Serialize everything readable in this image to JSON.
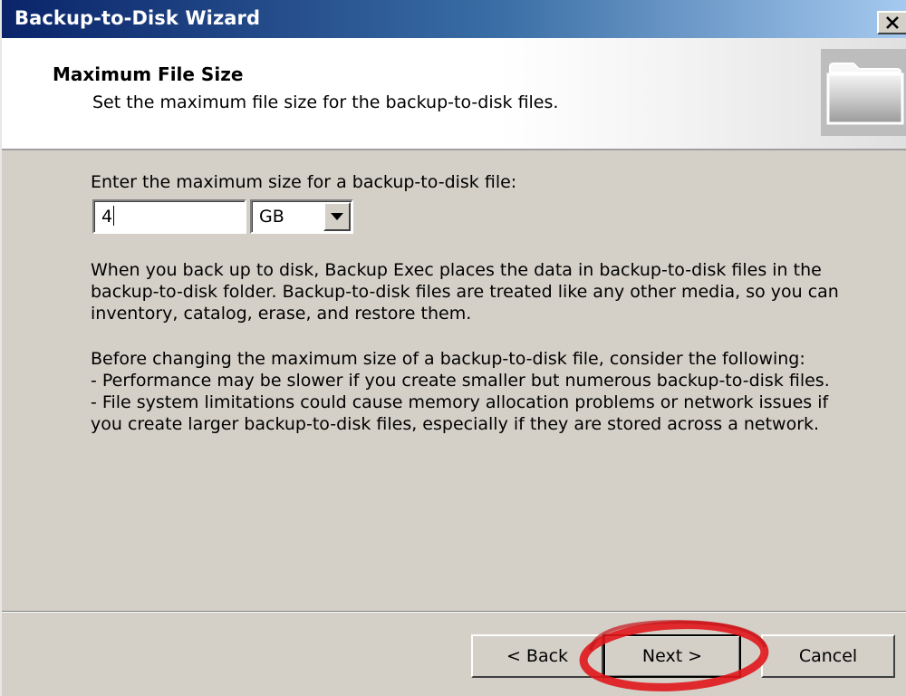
{
  "window": {
    "title": "Backup-to-Disk Wizard"
  },
  "header": {
    "title": "Maximum File Size",
    "subtitle": "Set the maximum file size for the backup-to-disk files.",
    "icon": "folder-icon"
  },
  "form": {
    "prompt": "Enter the maximum size for a backup-to-disk file:",
    "size_value": "4",
    "unit_selected": "GB"
  },
  "info": {
    "paragraph1": "When you back up to disk, Backup Exec places the data in backup-to-disk files in the backup-to-disk folder. Backup-to-disk files are treated like any other media, so you can inventory, catalog, erase, and restore them.",
    "paragraph2_lines": [
      "Before changing the maximum size of a backup-to-disk file, consider the following:",
      "- Performance may be slower if you create smaller but numerous backup-to-disk files.",
      "- File system limitations could cause memory allocation problems or network issues if you create larger backup-to-disk files, especially if they are stored across a network."
    ]
  },
  "buttons": {
    "back": "< Back",
    "next": "Next >",
    "cancel": "Cancel"
  },
  "colors": {
    "titlebar_start": "#0a246a",
    "titlebar_end": "#a6caf0",
    "dialog_bg": "#d4d0c8",
    "highlight_ring": "#e0161b"
  }
}
